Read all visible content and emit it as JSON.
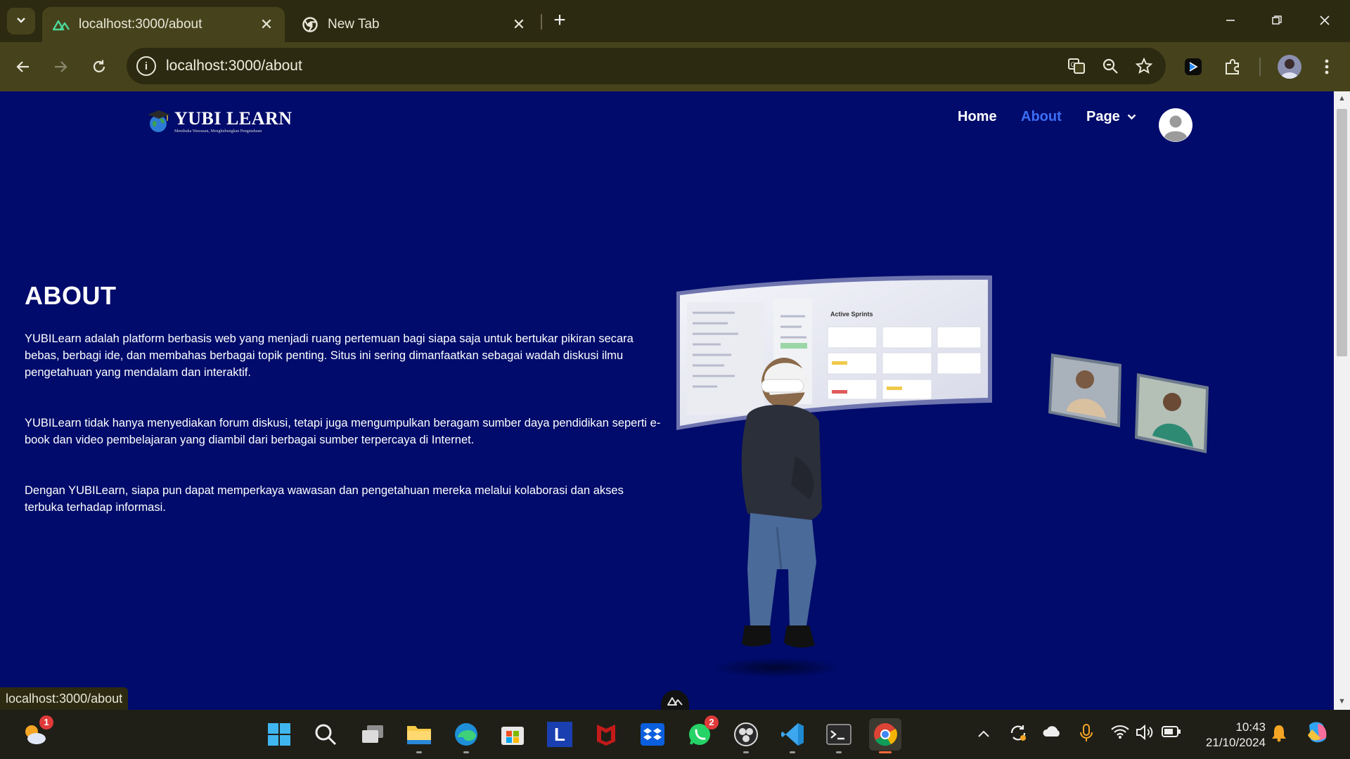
{
  "browser": {
    "tabs": [
      {
        "title": "localhost:3000/about",
        "active": true,
        "icon": "nuxt-icon"
      },
      {
        "title": "New Tab",
        "active": false,
        "icon": "chrome-icon"
      }
    ],
    "new_tab_glyph": "+",
    "address": "localhost:3000/about",
    "status_url": "localhost:3000/about"
  },
  "site": {
    "logo": {
      "name": "YUBI LEARN",
      "tagline": "Membuka Wawasan, Menghubungkan Pengetahuan"
    },
    "nav": {
      "home": "Home",
      "about": "About",
      "page": "Page"
    },
    "active_nav": "About",
    "accent_color": "#3d6ef5",
    "background_color": "#000b6b"
  },
  "about": {
    "heading": "ABOUT",
    "paragraphs": [
      "YUBILearn adalah platform berbasis web yang menjadi ruang pertemuan bagi siapa saja untuk bertukar pikiran secara bebas, berbagi ide, dan membahas berbagai topik penting. Situs ini sering dimanfaatkan sebagai wadah diskusi ilmu pengetahuan yang mendalam dan interaktif.",
      "YUBILearn tidak hanya menyediakan forum diskusi, tetapi juga mengumpulkan beragam sumber daya pendidikan seperti e-book dan video pembelajaran yang diambil dari berbagai sumber terpercaya di Internet.",
      "Dengan YUBILearn, siapa pun dapat memperkaya wawasan dan pengetahuan mereka melalui kolaborasi dan akses terbuka terhadap informasi."
    ],
    "hero": {
      "panel_title": "Active Sprints"
    }
  },
  "taskbar": {
    "weather_badge": "1",
    "whatsapp_badge": "2",
    "launcher_letter": "L",
    "time": "10:43",
    "date": "21/10/2024"
  }
}
